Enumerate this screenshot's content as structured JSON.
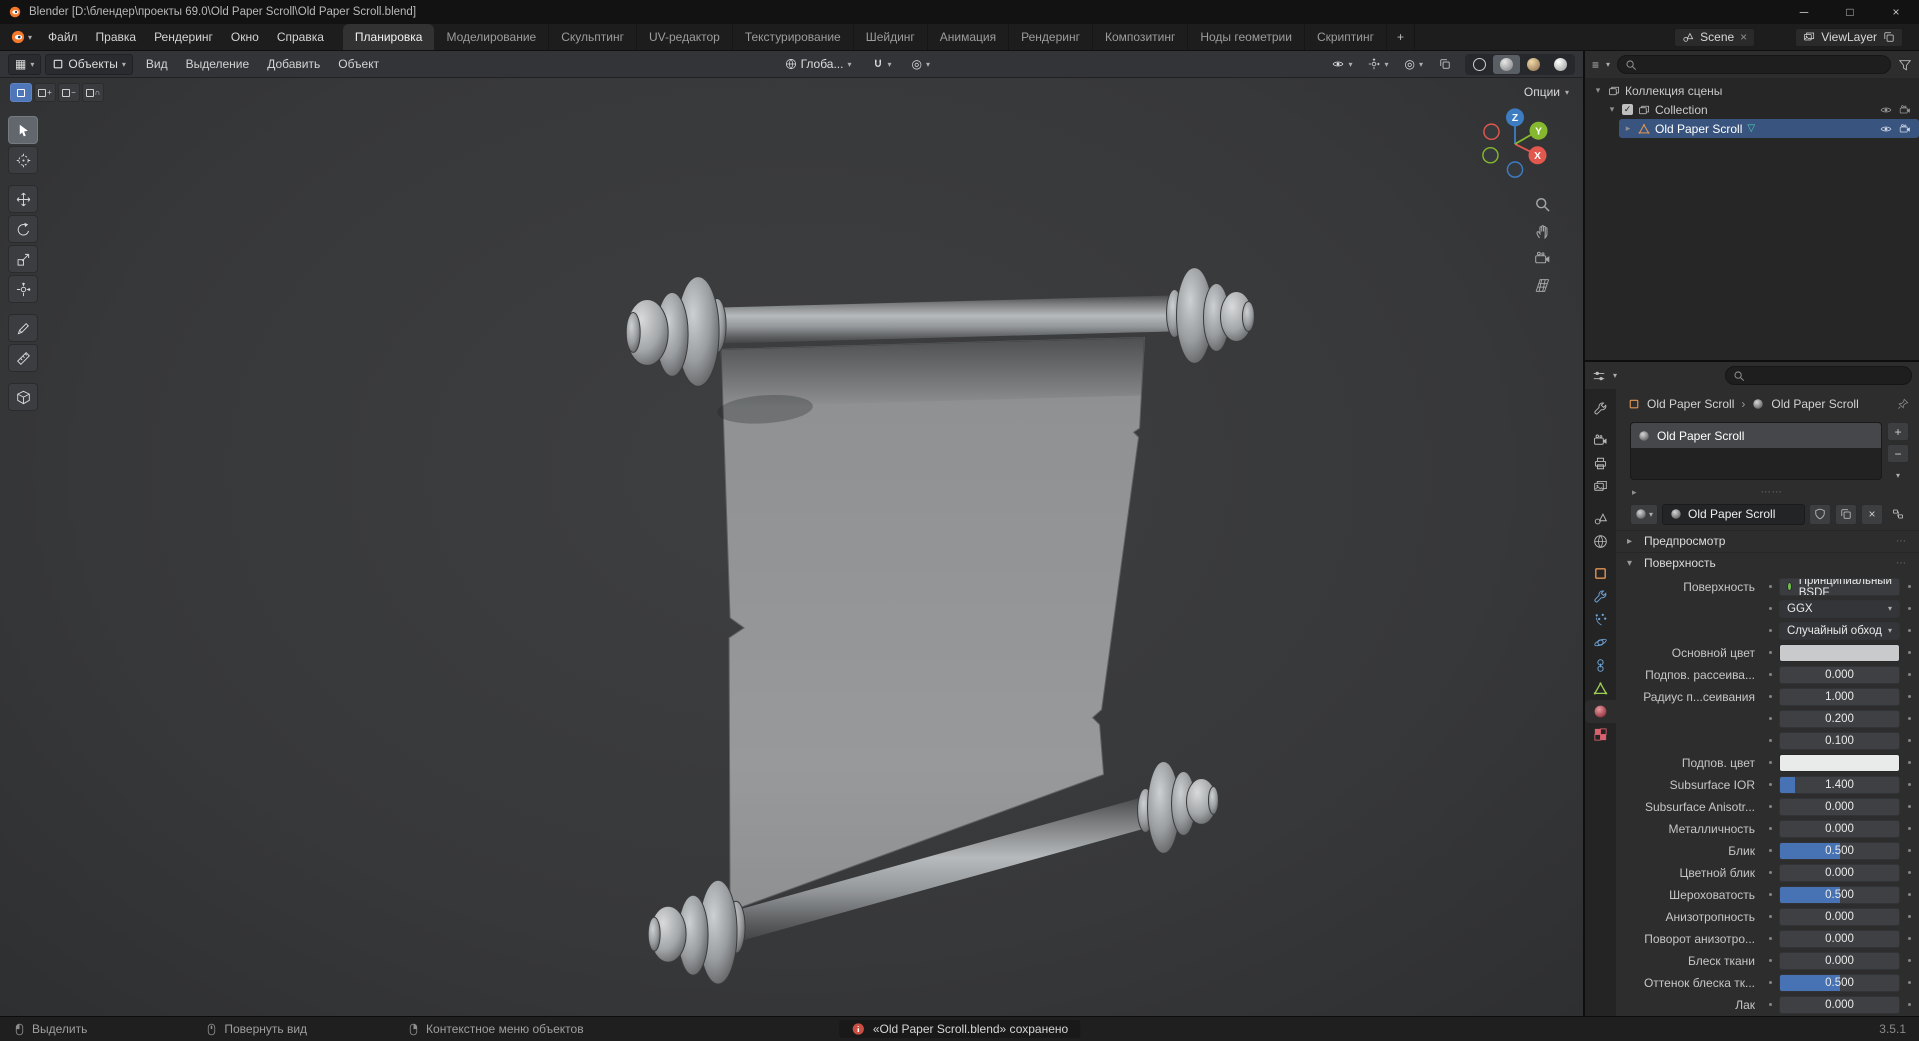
{
  "colors": {
    "accent_blue": "#4772b3",
    "selection_blue": "#39557f",
    "object_orange": "#e09553",
    "mesh_data_teal": "#4ecfb2",
    "data_green": "#9ece56",
    "material_red": "#d8636f",
    "axis_x": "#e2574e",
    "axis_y": "#86b82f",
    "axis_z": "#3e7cc1",
    "viewport_bg": "#37383a",
    "notification_icon": "#c94f43"
  },
  "title_bar": {
    "title": "Blender [D:\\блендер\\проекты 69.0\\Old Paper Scroll\\Old Paper Scroll.blend]",
    "controls": [
      "─",
      "□",
      "×"
    ]
  },
  "menu_bar": {
    "menus": [
      "Файл",
      "Правка",
      "Рендеринг",
      "Окно",
      "Справка"
    ],
    "workspaces": [
      "Планировка",
      "Моделирование",
      "Скульптинг",
      "UV-редактор",
      "Текстурирование",
      "Шейдинг",
      "Анимация",
      "Рендеринг",
      "Композитинг",
      "Ноды геометрии",
      "Скриптинг"
    ],
    "active_workspace": 0,
    "add_tab": "+",
    "scene_label": "Scene",
    "view_layer_label": "ViewLayer"
  },
  "viewport": {
    "header": {
      "mode": "Объекты",
      "menus": [
        "Вид",
        "Выделение",
        "Добавить",
        "Объект"
      ],
      "orientation": "Глоба...",
      "shading_modes": [
        "wireframe",
        "solid",
        "material",
        "rendered"
      ],
      "active_shading": "solid"
    },
    "tool_settings": {
      "options_label": "Опции",
      "select_mode_glyphs": [
        "",
        "+",
        "−",
        "∩"
      ]
    },
    "gizmo": {
      "x": "X",
      "y": "Y",
      "z": "Z"
    },
    "toolbar": [
      {
        "name": "select-box",
        "icon": "cursor",
        "active": true
      },
      {
        "name": "cursor-3d",
        "icon": "crosshair"
      },
      {
        "name": "move",
        "icon": "move",
        "gap": true
      },
      {
        "name": "rotate",
        "icon": "rotate"
      },
      {
        "name": "scale",
        "icon": "scale"
      },
      {
        "name": "transform",
        "icon": "transf"
      },
      {
        "name": "annotate",
        "icon": "pen",
        "gap": true
      },
      {
        "name": "measure",
        "icon": "ruler"
      },
      {
        "name": "add-cube",
        "icon": "cube",
        "gap": true
      }
    ]
  },
  "outliner": {
    "search_placeholder": "",
    "rows": [
      {
        "label": "Коллекция сцены"
      },
      {
        "label": "Collection"
      },
      {
        "label": "Old Paper Scroll",
        "selected": true
      }
    ]
  },
  "properties": {
    "search_placeholder": "",
    "breadcrumb": {
      "object": "Old Paper Scroll",
      "separator": "›",
      "material": "Old Paper Scroll"
    },
    "tabs": [
      {
        "name": "tool",
        "icon": "wrench",
        "color": "#b9b9b9"
      },
      {
        "name": "render",
        "icon": "cam",
        "color": "#b9b9b9",
        "gap": true
      },
      {
        "name": "output",
        "icon": "printer",
        "color": "#b9b9b9"
      },
      {
        "name": "view-layer",
        "icon": "images",
        "color": "#b9b9b9"
      },
      {
        "name": "scene",
        "icon": "scene",
        "color": "#b9b9b9",
        "gap": true
      },
      {
        "name": "world",
        "icon": "globe",
        "color": "#b9b9b9"
      },
      {
        "name": "object",
        "icon": "square",
        "color": "#e09553",
        "gap": true
      },
      {
        "name": "modifiers",
        "icon": "wrench",
        "color": "#71a8dc"
      },
      {
        "name": "particles",
        "icon": "dots",
        "color": "#71a8dc"
      },
      {
        "name": "physics",
        "icon": "orbit",
        "color": "#71a8dc"
      },
      {
        "name": "constraints",
        "icon": "chain",
        "color": "#71a8dc"
      },
      {
        "name": "data",
        "icon": "tri",
        "color": "#9ece56"
      },
      {
        "name": "material",
        "icon": "sphere-red",
        "color": "#d8636f",
        "active": true
      },
      {
        "name": "texture",
        "icon": "checker",
        "color": "#d8636f"
      }
    ],
    "slot_name": "Old Paper Scroll",
    "material_name": "Old Paper Scroll",
    "panels": {
      "preview": "Предпросмотр",
      "surface": "Поверхность"
    },
    "surface_rows": [
      {
        "label": "Поверхность",
        "type": "shader",
        "value": "Принципиальный BSDF"
      },
      {
        "label": "",
        "type": "dropdown",
        "value": "GGX"
      },
      {
        "label": "",
        "type": "dropdown",
        "value": "Случайный обход"
      },
      {
        "label": "Основной цвет",
        "type": "color",
        "color": "#c9cacb"
      },
      {
        "label": "Подпов. рассеива...",
        "type": "value",
        "value": "0.000",
        "fill": 0
      },
      {
        "label": "Радиус п...сеивания",
        "type": "value",
        "value": "1.000",
        "fill": 0
      },
      {
        "label": "",
        "type": "value",
        "value": "0.200",
        "fill": 0
      },
      {
        "label": "",
        "type": "value",
        "value": "0.100",
        "fill": 0
      },
      {
        "label": "Подпов. цвет",
        "type": "color",
        "color": "#e9eaea"
      },
      {
        "label": "Subsurface IOR",
        "type": "value",
        "value": "1.400",
        "fill": 13
      },
      {
        "label": "Subsurface Anisotr...",
        "type": "value",
        "value": "0.000",
        "fill": 0
      },
      {
        "label": "Металличность",
        "type": "value",
        "value": "0.000",
        "fill": 0
      },
      {
        "label": "Блик",
        "type": "value",
        "value": "0.500",
        "fill": 50
      },
      {
        "label": "Цветной блик",
        "type": "value",
        "value": "0.000",
        "fill": 0
      },
      {
        "label": "Шероховатость",
        "type": "value",
        "value": "0.500",
        "fill": 50
      },
      {
        "label": "Анизотропность",
        "type": "value",
        "value": "0.000",
        "fill": 0
      },
      {
        "label": "Поворот анизотро...",
        "type": "value",
        "value": "0.000",
        "fill": 0
      },
      {
        "label": "Блеск ткани",
        "type": "value",
        "value": "0.000",
        "fill": 0
      },
      {
        "label": "Оттенок блеска тк...",
        "type": "value",
        "value": "0.500",
        "fill": 50
      },
      {
        "label": "Лак",
        "type": "value",
        "value": "0.000",
        "fill": 0
      }
    ]
  },
  "status_bar": {
    "hints": [
      {
        "mouse": "left",
        "label": "Выделить"
      },
      {
        "mouse": "middle",
        "label": "Повернуть вид"
      },
      {
        "mouse": "right",
        "label": "Контекстное меню объектов"
      }
    ],
    "notification": "«Old Paper Scroll.blend» сохранено",
    "version": "3.5.1"
  }
}
